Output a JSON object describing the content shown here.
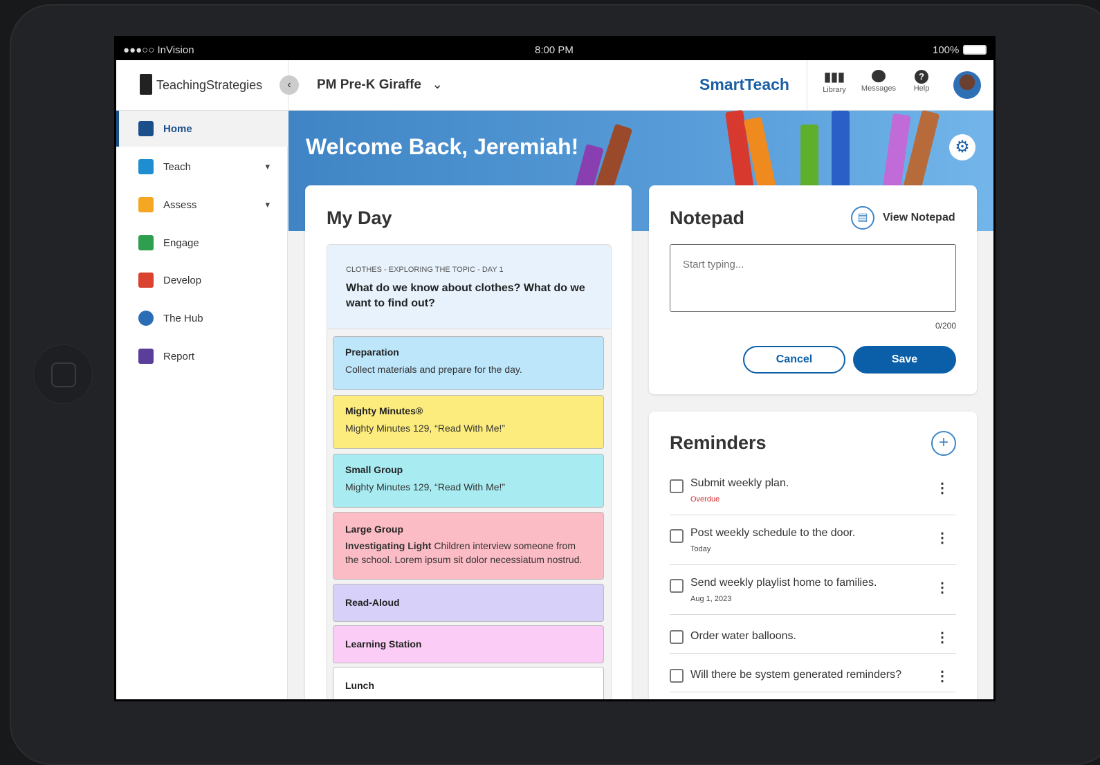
{
  "status": {
    "carrier": "●●●○○ InVision",
    "time": "8:00 PM",
    "battery": "100%"
  },
  "header": {
    "logo": "TeachingStrategies",
    "classroom": "PM Pre-K Giraffe",
    "brand": "SmartTeach",
    "icons": [
      {
        "label": "Library",
        "icon": "library-icon"
      },
      {
        "label": "Messages",
        "icon": "messages-icon"
      },
      {
        "label": "Help",
        "icon": "help-icon"
      }
    ]
  },
  "sidebar": {
    "items": [
      {
        "label": "Home",
        "color": "#1b4f8a"
      },
      {
        "label": "Teach",
        "color": "#1e8ed0"
      },
      {
        "label": "Assess",
        "color": "#f5a623"
      },
      {
        "label": "Engage",
        "color": "#2e9e4f"
      },
      {
        "label": "Develop",
        "color": "#d9432f"
      },
      {
        "label": "The Hub",
        "color": "#2a6db5"
      },
      {
        "label": "Report",
        "color": "#5a3e99"
      }
    ]
  },
  "banner": {
    "welcome": "Welcome Back, Jeremiah!"
  },
  "myday": {
    "title": "My Day",
    "topic": "CLOTHES - EXPLORING THE TOPIC - DAY 1",
    "question": "What do we know about clothes? What do we want to find out?",
    "activities": [
      {
        "title": "Preparation",
        "desc": "Collect materials and prepare for the day.",
        "color": "#bde6fb"
      },
      {
        "title": "Mighty Minutes®",
        "desc": "Mighty Minutes 129, “Read With Me!”",
        "color": "#fcec7d"
      },
      {
        "title": "Small Group",
        "desc": "Mighty Minutes 129, “Read With Me!”",
        "color": "#a8ecf2"
      },
      {
        "title": "Large Group",
        "desc_bold": "Investigating Light",
        "desc": " Children interview someone from the school. Lorem ipsum sit dolor necessiatum nostrud.",
        "color": "#fcbcc5"
      },
      {
        "title": "Read-Aloud",
        "color": "#d7d1fa"
      },
      {
        "title": "Learning Station",
        "color": "#fbcdf6"
      },
      {
        "title": "Lunch",
        "color": "#ffffff"
      }
    ]
  },
  "notepad": {
    "title": "Notepad",
    "view": "View Notepad",
    "placeholder": "Start typing...",
    "count": "0/200",
    "cancel": "Cancel",
    "save": "Save"
  },
  "reminders": {
    "title": "Reminders",
    "items": [
      {
        "text": "Submit weekly plan.",
        "sub": "Overdue",
        "overdue": true
      },
      {
        "text": "Post weekly schedule to the door.",
        "sub": "Today"
      },
      {
        "text": "Send weekly playlist home to families.",
        "sub": "Aug 1, 2023"
      },
      {
        "text": "Order water balloons."
      },
      {
        "text": "Will there be system generated reminders?"
      }
    ]
  },
  "colors": {
    "accent": "#0a5fa8",
    "overdue": "#d32f2f"
  }
}
